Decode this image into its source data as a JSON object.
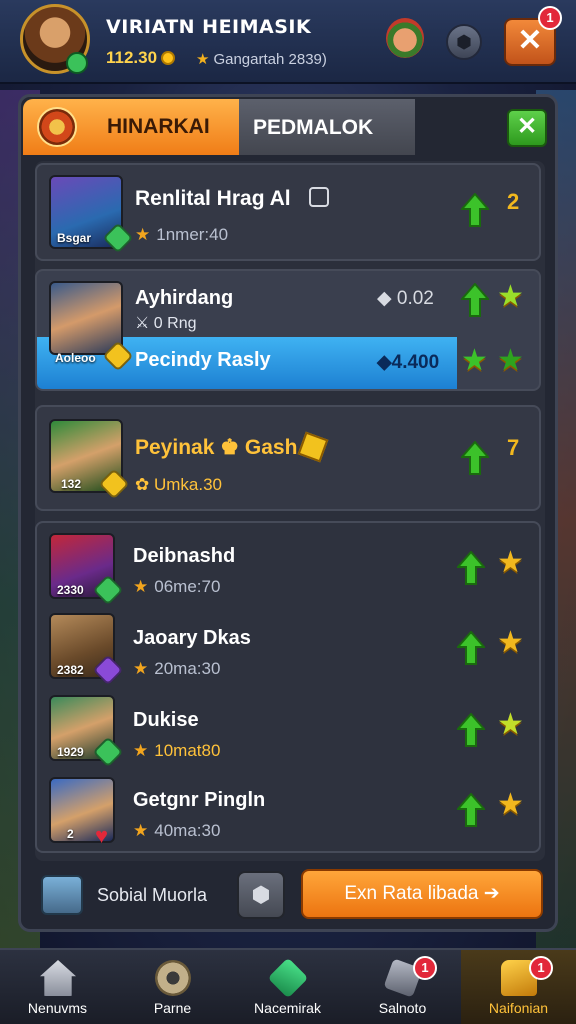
{
  "header": {
    "player_name": "VIRIATN HEIMASIK",
    "coins": "112.30",
    "status_text": "Gangartah 2839)",
    "notification_count": "1"
  },
  "tabs": [
    {
      "label": "HINARKAI",
      "active": true
    },
    {
      "label": "PEDMALOK",
      "active": false
    }
  ],
  "entries": [
    {
      "name": "Renlital Hrag Al",
      "meta": "1nmer:40",
      "tag": "Bsgar",
      "rank": "2"
    },
    {
      "name": "Ayhirdang",
      "meta": "0 Rng",
      "tag": "Aoleoo",
      "value": "0.02",
      "highlight_label": "Pecindy Rasly",
      "highlight_value": "4.400"
    },
    {
      "name": "Peyinak",
      "name_suffix": "Gash",
      "meta": "Umka.30",
      "tag": "132",
      "rank": "7"
    },
    {
      "name": "Deibnashd",
      "meta": "06me:70",
      "tag": "2330"
    },
    {
      "name": "Jaoary Dkas",
      "meta": "20ma:30",
      "tag": "2382"
    },
    {
      "name": "Dukise",
      "meta": "10mat80",
      "tag": "1929"
    },
    {
      "name": "Getgnr Pingln",
      "meta": "40ma:30",
      "tag": "2"
    }
  ],
  "footer": {
    "social_label": "Sobial Muorla",
    "cta_label": "Exn Rata libada"
  },
  "bottom_nav": [
    {
      "label": "Nenuvms",
      "icon": "house-icon"
    },
    {
      "label": "Parne",
      "icon": "gear-icon"
    },
    {
      "label": "Nacemirak",
      "icon": "gem-icon"
    },
    {
      "label": "Salnoto",
      "icon": "shield-icon",
      "badge": "1"
    },
    {
      "label": "Naifonian",
      "icon": "chest-icon",
      "badge": "1",
      "active": true
    }
  ],
  "colors": {
    "accent_orange": "#f07d17",
    "highlight_blue": "#1d80d2",
    "up_green": "#3cc22a",
    "star_gold": "#f2b81e"
  }
}
